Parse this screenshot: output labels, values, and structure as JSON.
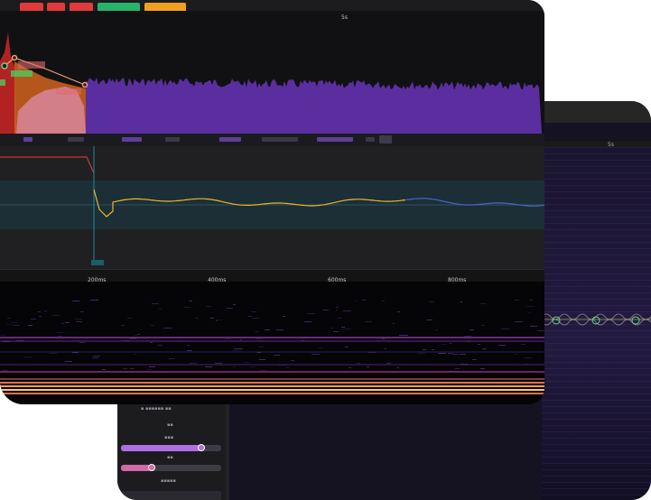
{
  "front": {
    "tags": [
      {
        "label": "",
        "color": "#e23a3a"
      },
      {
        "label": "",
        "color": "#e23a3a"
      },
      {
        "label": "",
        "color": "#e23a3a"
      },
      {
        "label": "",
        "color": "#27b36a"
      },
      {
        "label": "",
        "color": "#f0a020"
      }
    ],
    "top_ruler": {
      "marker": "5s"
    },
    "time_ruler": {
      "ticks": [
        "200ms",
        "400ms",
        "600ms",
        "800ms"
      ]
    },
    "colors": {
      "amplitude_fill": "#5b2ea0",
      "attack_red": "#b32222",
      "decay_orange": "#d2641e",
      "sustain_pink": "#d98aa6",
      "pitch_line": "#f0b429",
      "pitch_line_tail": "#4a63c8",
      "playhead": "#1b8b96",
      "envelope_handle": "#f2a074"
    }
  },
  "back": {
    "ruler": {
      "marker": "5s"
    },
    "panel": {
      "slider_purple_value": 0.8,
      "slider_pink_value": 0.3,
      "colors": {
        "purple": "#b06fe0",
        "pink": "#d16aa8"
      }
    }
  }
}
